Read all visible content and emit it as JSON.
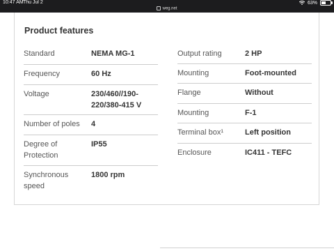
{
  "status_bar": {
    "time": "10:47 AM",
    "date": "Thu Jul 2",
    "url": "weg.net",
    "battery": "63%",
    "battery_level": 0.63
  },
  "section": {
    "title": "Product features"
  },
  "left_column": [
    {
      "label": "Standard",
      "value": "NEMA MG-1"
    },
    {
      "label": "Frequency",
      "value": "60 Hz"
    },
    {
      "label": "Voltage",
      "value": "230/460//190-220/380-415 V"
    },
    {
      "label": "Number of poles",
      "value": "4"
    },
    {
      "label": "Degree of Protection",
      "value": "IP55"
    },
    {
      "label": "Synchronous speed",
      "value": "1800 rpm"
    }
  ],
  "right_column": [
    {
      "label": "Output rating",
      "value": "2 HP"
    },
    {
      "label": "Mounting",
      "value": "Foot-mounted"
    },
    {
      "label": "Flange",
      "value": "Without"
    },
    {
      "label": "Mounting",
      "value": "F-1"
    },
    {
      "label": "Terminal box¹",
      "value": "Left position"
    },
    {
      "label": "Enclosure",
      "value": "IC411 - TEFC"
    }
  ]
}
